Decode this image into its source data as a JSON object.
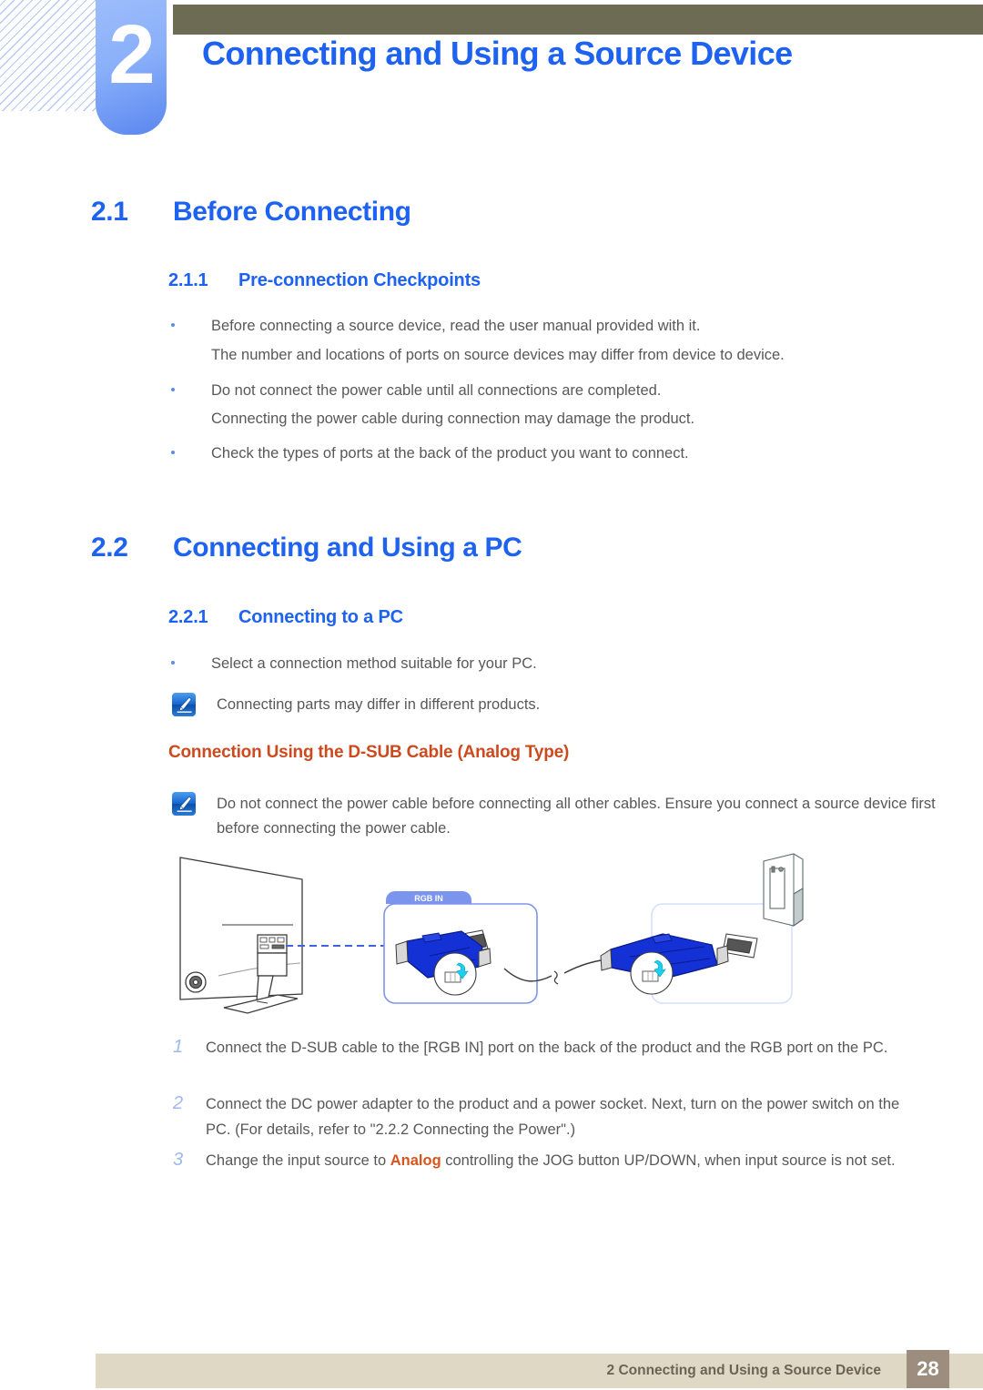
{
  "chapter": {
    "number": "2",
    "title": "Connecting and Using a Source Device"
  },
  "sections": [
    {
      "number": "2.1",
      "title": "Before Connecting",
      "subsection": {
        "number": "2.1.1",
        "title": "Pre-connection Checkpoints"
      }
    },
    {
      "number": "2.2",
      "title": "Connecting and Using a PC",
      "subsection": {
        "number": "2.2.1",
        "title": "Connecting to a PC"
      }
    }
  ],
  "checkpoints": {
    "bullet1": "Before connecting a source device, read the user manual provided with it.",
    "bullet1_sub": "The number and locations of ports on source devices may differ from device to device.",
    "bullet2": "Do not connect the power cable until all connections are completed.",
    "bullet2_sub": "Connecting the power cable during connection may damage the product.",
    "bullet3": "Check the types of ports at the back of the product you want to connect."
  },
  "connecting_pc": {
    "bullet1": "Select a connection method suitable for your PC.",
    "note1": "Connecting parts may differ in different products.",
    "dsub_heading": "Connection Using the D-SUB Cable (Analog Type)",
    "note2": "Do not connect the power cable before connecting all other cables. Ensure you connect a source device first before connecting the power cable."
  },
  "diagram": {
    "port_label": "RGB IN"
  },
  "steps": [
    {
      "number": "1",
      "text": "Connect the D-SUB cable to the [RGB IN] port on the back of the product and the RGB port on the PC."
    },
    {
      "number": "2",
      "text": "Connect the DC power adapter to the product and a power socket. Next, turn on the power switch on the PC. (For details, refer to \"2.2.2    Connecting the Power\".)"
    },
    {
      "number": "3",
      "text_before": "Change the input source to ",
      "highlight": "Analog",
      "text_after": " controlling the JOG button UP/DOWN, when input source is not set."
    }
  ],
  "footer": {
    "text": "2 Connecting and Using a Source Device",
    "page": "28"
  },
  "colors": {
    "heading_blue": "#1d62f0",
    "accent_orange": "#cc4a1e",
    "olive_bar": "#6e6b55",
    "footer_bar": "#ded8c4",
    "page_box": "#9c8d7e",
    "body_gray": "#58585a",
    "step_number": "#9fb8ef",
    "tab_blue": "#7b95ef",
    "connector_blue": "#1431d6"
  }
}
